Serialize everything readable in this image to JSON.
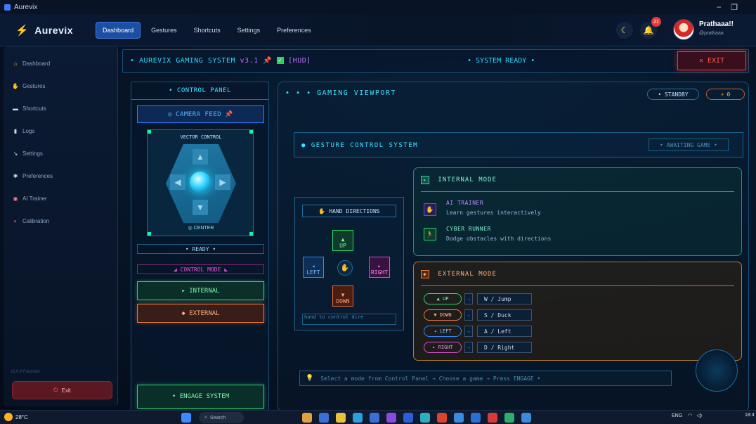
{
  "window": {
    "title": "Aurevix",
    "minimize_icon": "minimize-icon",
    "maximize_icon": "maximize-icon"
  },
  "nav": {
    "brand": "Aurevix",
    "links": [
      "Dashboard",
      "Gestures",
      "Shortcuts",
      "Settings",
      "Preferences"
    ],
    "active": "Dashboard",
    "notification_count": "21",
    "user_name": "Prathaaa!!",
    "user_handle": "@prathaaa"
  },
  "sidebar": {
    "items": [
      {
        "label": "Dashboard",
        "icon": "home-icon"
      },
      {
        "label": "Gestures",
        "icon": "hand-icon"
      },
      {
        "label": "Shortcuts",
        "icon": "keyboard-icon"
      },
      {
        "label": "Logs",
        "icon": "document-icon"
      },
      {
        "label": "Settings",
        "icon": "wrench-icon"
      },
      {
        "label": "Preferences",
        "icon": "gear-icon"
      },
      {
        "label": "AI Trainer",
        "icon": "robot-icon"
      },
      {
        "label": "Calibration",
        "icon": "target-icon"
      }
    ],
    "version": "v2.0.0 Futuristic",
    "exit_label": "Exit"
  },
  "hud": {
    "title": "• AUREVIX GAMING SYSTEM",
    "version": "v3.1",
    "tag": "[HUD]",
    "status": "• SYSTEM READY •",
    "exit_label": "✕ EXIT"
  },
  "control_panel": {
    "title": "• CONTROL PANEL",
    "camera_feed": "CAMERA FEED",
    "vector_label": "VECTOR CONTROL",
    "center_label": "CENTER",
    "ready": "• READY •",
    "control_mode": "◢ CONTROL MODE ◣",
    "internal_btn": "▸ INTERNAL",
    "external_btn": "◆ EXTERNAL",
    "engage_btn": "• ENGAGE SYSTEM"
  },
  "viewport": {
    "title": "• • •   GAMING VIEWPORT",
    "standby": "• STANDBY",
    "counter": "0",
    "gcs_title": "● GESTURE CONTROL SYSTEM",
    "gcs_status": "• AWAITING GAME •",
    "hand": {
      "title": "HAND DIRECTIONS",
      "up": "UP",
      "down": "DOWN",
      "left": "LEFT",
      "right": "RIGHT",
      "input_text": "hand to control dire"
    },
    "internal": {
      "title": "INTERNAL MODE",
      "games": [
        {
          "name": "AI TRAINER",
          "desc": "Learn gestures interactively"
        },
        {
          "name": "CYBER RUNNER",
          "desc": "Dodge obstacles with directions"
        }
      ]
    },
    "external": {
      "title": "EXTERNAL MODE",
      "keys": [
        {
          "dir": "▲ UP",
          "key": "W / Jump",
          "color": "#2bd66a"
        },
        {
          "dir": "▼ DOWN",
          "key": "S / Duck",
          "color": "#f07a3a"
        },
        {
          "dir": "◂ LEFT",
          "key": "A / Left",
          "color": "#2b8bff"
        },
        {
          "dir": "▸ RIGHT",
          "key": "D / Right",
          "color": "#d84fd0"
        }
      ]
    },
    "hint": "Select a mode from Control Panel  →  Choose a game  →  Press ENGAGE •"
  },
  "taskbar": {
    "weather": "28°C",
    "search": "Search",
    "lang": "ENG",
    "time": "18:4"
  },
  "colors": {
    "accent": "#26d9ff",
    "exit": "#e23a3a",
    "internal": "#2bd66a",
    "external": "#f07a3a"
  }
}
